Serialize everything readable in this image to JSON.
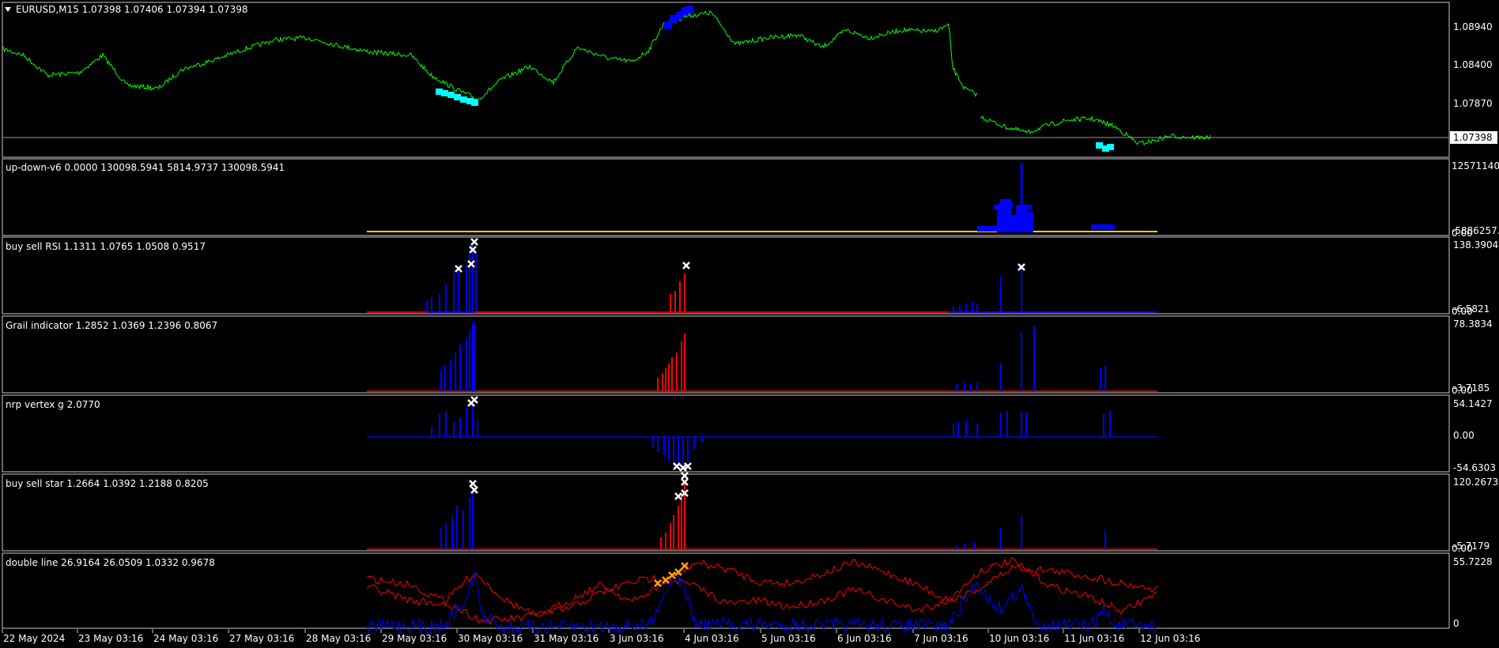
{
  "colors": {
    "background": "#000000",
    "frame": "#c8c8c8",
    "price": "#00ff00",
    "blue": "#0000ff",
    "red": "#ff0000",
    "yellow": "#ffd200",
    "cyan": "#00ffff",
    "orange": "#ffa500",
    "marker": "#ffffff"
  },
  "chart": {
    "symbol_header": "EURUSD,M15  1.07398 1.07406 1.07394 1.07398",
    "collapse_icon": "triangle-down-icon",
    "current_price": "1.07398",
    "time_labels": [
      "22 May 2024",
      "23 May 03:16",
      "24 May 03:16",
      "27 May 03:16",
      "28 May 03:16",
      "29 May 03:16",
      "30 May 03:16",
      "31 May 03:16",
      "3 Jun 03:16",
      "4 Jun 03:16",
      "5 Jun 03:16",
      "6 Jun 03:16",
      "7 Jun 03:16",
      "10 Jun 03:16",
      "11 Jun 03:16",
      "12 Jun 03:16"
    ]
  },
  "panes": [
    {
      "name": "price",
      "title": "",
      "scale": [
        "1.08940",
        "1.08400",
        "1.07870",
        "1.07398"
      ]
    },
    {
      "name": "up-down-v6",
      "title": "up-down-v6 0.0000 130098.5941 5814.9737 130098.5941",
      "scale": [
        "12571140",
        "-5886257.5",
        "0.00"
      ]
    },
    {
      "name": "buy-sell-rsi",
      "title": "buy sell RSI 1.1311 1.0765 1.0508 0.9517",
      "scale": [
        "138.3904",
        "-6.5821",
        "0.00"
      ]
    },
    {
      "name": "grail-indicator",
      "title": "Grail indicator 1.2852 1.0369 1.2396 0.8067",
      "scale": [
        "78.3834",
        "-3.7185",
        "0.00"
      ]
    },
    {
      "name": "nrp-vertex-g",
      "title": "nrp vertex g 2.0770",
      "scale": [
        "54.1427",
        "0.00",
        "-54.6303"
      ]
    },
    {
      "name": "buy-sell-star",
      "title": "buy sell star 1.2664 1.0392 1.2188 0.8205",
      "scale": [
        "120.2673",
        "-5.7179",
        "0.00"
      ]
    },
    {
      "name": "double-line",
      "title": "double line 26.9164 26.0509 1.0332 0.9678",
      "scale": [
        "55.7228",
        "0"
      ]
    }
  ]
}
